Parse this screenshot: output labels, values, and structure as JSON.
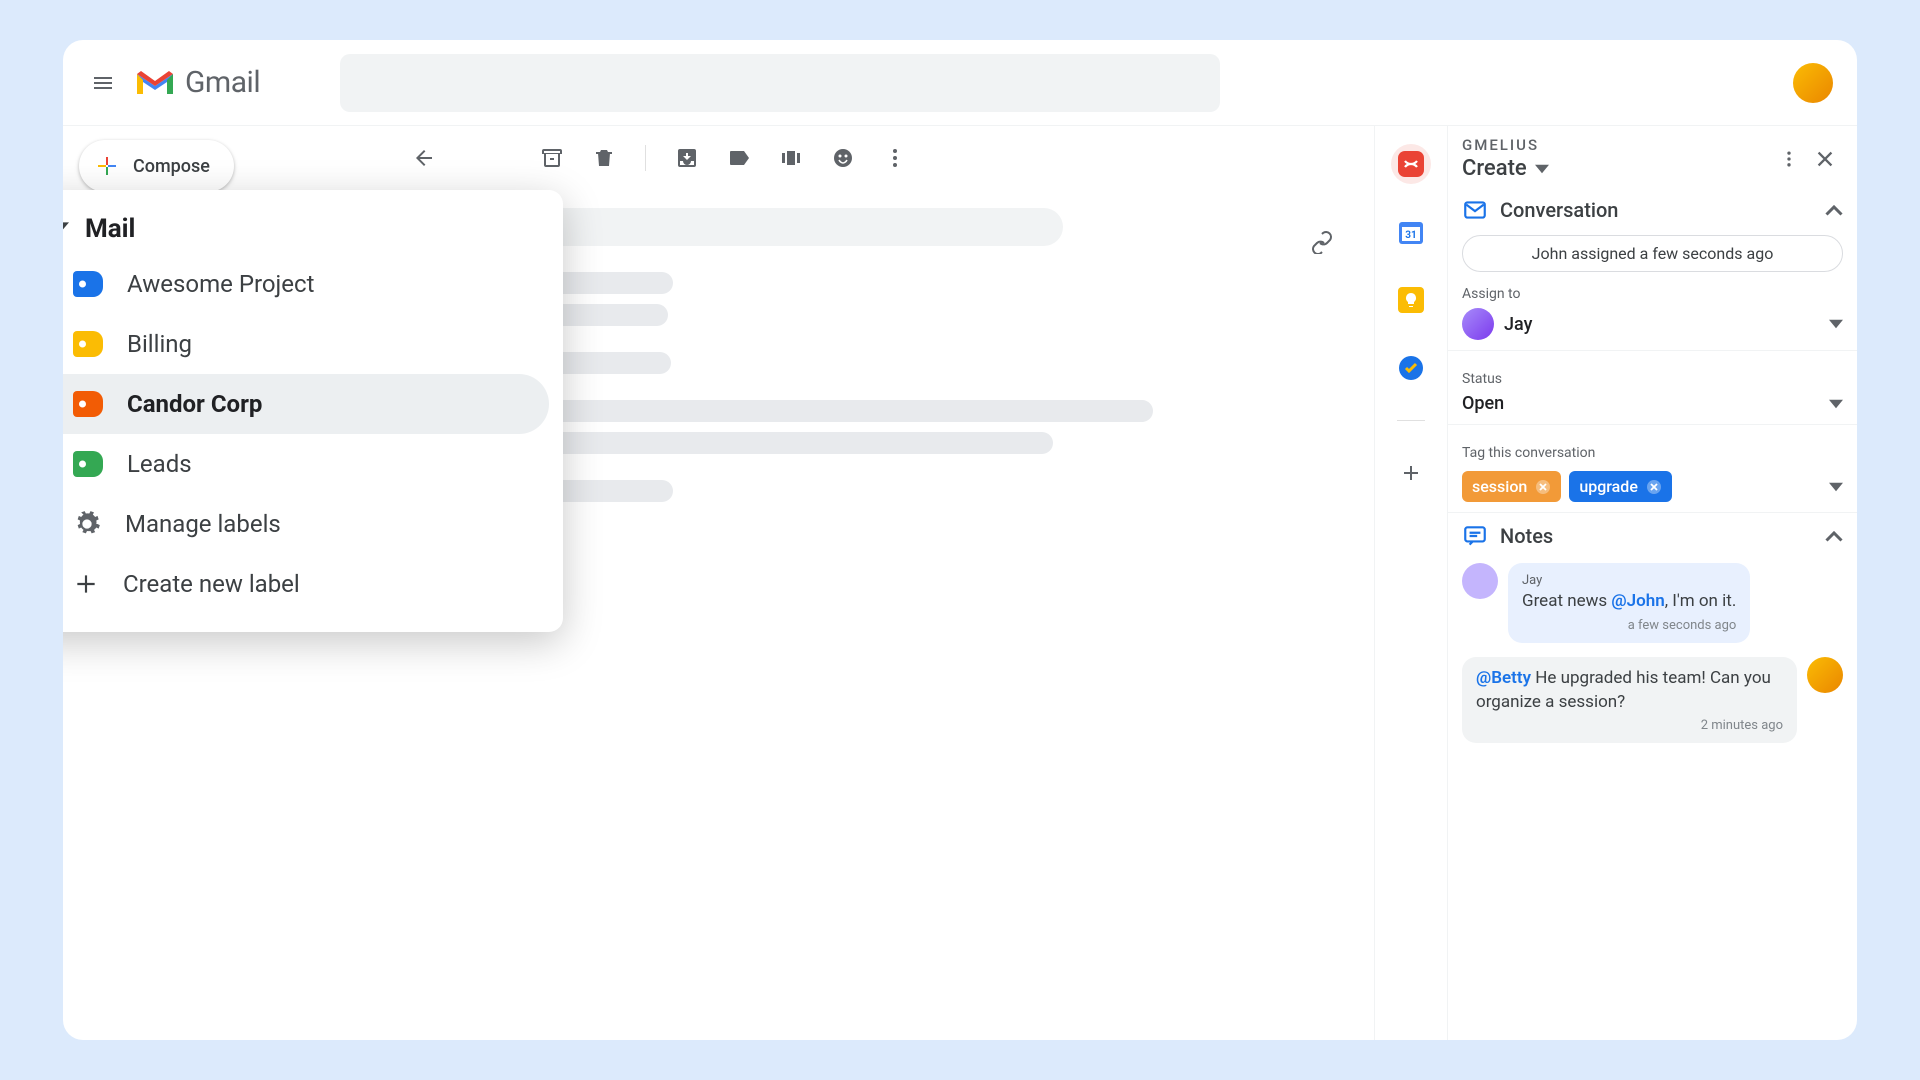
{
  "app": {
    "name": "Gmail",
    "compose": "Compose"
  },
  "popover": {
    "heading": "Mail",
    "items": [
      {
        "label": "Awesome Project",
        "color": "blue"
      },
      {
        "label": "Billing",
        "color": "yellow"
      },
      {
        "label": "Candor Corp",
        "color": "orange",
        "selected": true
      },
      {
        "label": "Leads",
        "color": "green"
      }
    ],
    "manage": "Manage labels",
    "create": "Create new label"
  },
  "panel": {
    "brand": "GMELIUS",
    "create": "Create",
    "conversation": {
      "title": "Conversation",
      "activity": "John assigned a few seconds ago",
      "assign_label": "Assign to",
      "assignee": "Jay",
      "status_label": "Status",
      "status_value": "Open",
      "tag_label": "Tag this conversation",
      "tags": [
        "session",
        "upgrade"
      ]
    },
    "notes": {
      "title": "Notes",
      "items": [
        {
          "author": "Jay",
          "mention": "@John",
          "before": "Great news ",
          "after": ", I'm on it.",
          "time": "a few seconds ago",
          "side": "left"
        },
        {
          "mention": "@Betty",
          "after": " He upgraded his team! Can you organize a session?",
          "time": "2 minutes ago",
          "side": "right"
        }
      ]
    }
  }
}
